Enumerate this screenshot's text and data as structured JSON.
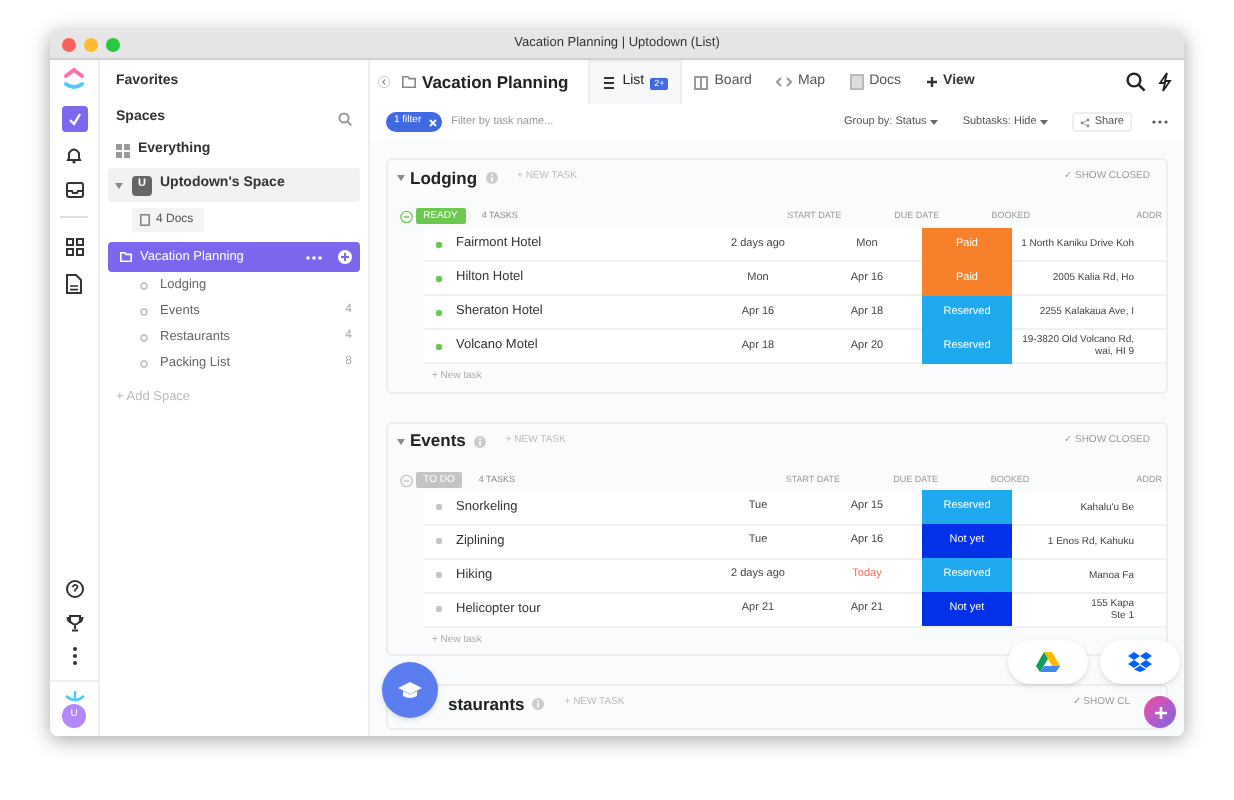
{
  "window": {
    "title": "Vacation Planning | Uptodown (List)"
  },
  "user": {
    "initial": "U"
  },
  "sidebar": {
    "favorites": "Favorites",
    "spaces": "Spaces",
    "everything": "Everything",
    "space": {
      "initial": "U",
      "name": "Uptodown's Space",
      "expanded": true
    },
    "docs": "4 Docs",
    "lists": [
      {
        "name": "Vacation Planning",
        "selected": true,
        "children": [
          {
            "name": "Lodging"
          },
          {
            "name": "Events",
            "count": "4"
          },
          {
            "name": "Restaurants",
            "count": "4"
          },
          {
            "name": "Packing List",
            "count": "8"
          }
        ]
      }
    ],
    "add_space": "+ Add Space"
  },
  "header": {
    "folder": "Vacation Planning",
    "views": [
      {
        "label": "List",
        "badge": "2+",
        "selected": true
      },
      {
        "label": "Board",
        "selected": false
      },
      {
        "label": "Map",
        "selected": false
      },
      {
        "label": "Docs",
        "selected": false
      }
    ],
    "add_view": "View"
  },
  "filters": {
    "chip": "1 filter",
    "placeholder": "Filter by task name...",
    "group_by": "Group by: Status",
    "subtasks": "Subtasks: Hide",
    "share": "Share"
  },
  "groups": [
    {
      "name": "Lodging",
      "new_task": "+ NEW TASK",
      "show_closed": "✓ SHOW CLOSED",
      "status": {
        "label": "READY",
        "color": "#6bc950"
      },
      "task_count": "4 TASKS",
      "columns": [
        "START DATE",
        "DUE DATE",
        "BOOKED",
        "ADDR"
      ],
      "tasks": [
        {
          "name": "Fairmont Hotel",
          "start": "2 days ago",
          "due": "Mon",
          "due_today": false,
          "booked": "Paid",
          "color": "#f7812a",
          "address": [
            "1 North Kaniku Drive Koh"
          ]
        },
        {
          "name": "Hilton Hotel",
          "start": "Mon",
          "due": "Apr 16",
          "due_today": false,
          "booked": "Paid",
          "color": "#f7812a",
          "address": [
            "2005 Kalia Rd, Ho"
          ]
        },
        {
          "name": "Sheraton Hotel",
          "start": "Apr 16",
          "due": "Apr 18",
          "due_today": false,
          "booked": "Reserved",
          "color": "#1faaf0",
          "address": [
            "2255 Kalakaua Ave, I"
          ]
        },
        {
          "name": "Volcano Motel",
          "start": "Apr 18",
          "due": "Apr 20",
          "due_today": false,
          "booked": "Reserved",
          "color": "#1faaf0",
          "address": [
            "19-3820 Old Volcano Rd,",
            "wai, HI 9"
          ]
        }
      ],
      "new_task_row": "+ New task"
    },
    {
      "name": "Events",
      "new_task": "+ NEW TASK",
      "show_closed": "✓ SHOW CLOSED",
      "status": {
        "label": "TO DO",
        "color": "#c4c4c4"
      },
      "task_count": "4 TASKS",
      "columns": [
        "START DATE",
        "DUE DATE",
        "BOOKED",
        "ADDR"
      ],
      "tasks": [
        {
          "name": "Snorkeling",
          "start": "Tue",
          "due": "Apr 15",
          "due_today": false,
          "booked": "Reserved",
          "color": "#1faaf0",
          "address": [
            "Kahalu'u Be"
          ]
        },
        {
          "name": "Ziplining",
          "start": "Tue",
          "due": "Apr 16",
          "due_today": false,
          "booked": "Not yet",
          "color": "#0231e8",
          "address": [
            "1 Enos Rd, Kahuku"
          ]
        },
        {
          "name": "Hiking",
          "start": "2 days ago",
          "due": "Today",
          "due_today": true,
          "booked": "Reserved",
          "color": "#1faaf0",
          "address": [
            "Manoa Fa"
          ]
        },
        {
          "name": "Helicopter tour",
          "start": "Apr 21",
          "due": "Apr 21",
          "due_today": false,
          "booked": "Not yet",
          "color": "#0231e8",
          "address": [
            "155 Kapa",
            "Ste 1"
          ]
        }
      ],
      "new_task_row": "+ New task"
    },
    {
      "name": "staurants",
      "new_task": "+ NEW TASK",
      "show_closed": "✓ SHOW CL"
    }
  ]
}
